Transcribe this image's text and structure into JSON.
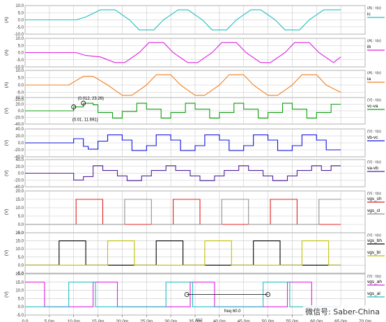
{
  "time_axis": {
    "label": "t(s)",
    "ticks": [
      "0.0",
      "5.0m",
      "10.0m",
      "15.0m",
      "20.0m",
      "25.0m",
      "30.0m",
      "35.0m",
      "40.0m",
      "45.0m",
      "50.0m",
      "55.0m",
      "60.0m",
      "65.0m",
      "70.0m"
    ],
    "xlim": [
      0,
      0.07
    ]
  },
  "watermark": "微信号: Saber-China",
  "chart_data": [
    {
      "type": "line",
      "ylabel": "(A)",
      "unit_label": "(A) : t(s)",
      "ylim": [
        -10,
        10
      ],
      "yticks": [
        "10.0",
        "5.0",
        "0.0",
        "-5.0",
        "-10.0"
      ],
      "series": [
        {
          "name": "ic",
          "color": "#20c0c0",
          "x": [
            0,
            0.0105,
            0.0125,
            0.0155,
            0.0185,
            0.0215,
            0.0235,
            0.0265,
            0.0285,
            0.0315,
            0.0335,
            0.0365,
            0.0385,
            0.0415,
            0.0435,
            0.0465,
            0.0485,
            0.0515,
            0.0535,
            0.0565,
            0.0585,
            0.0615,
            0.0635,
            0.065
          ],
          "y": [
            0,
            0,
            2,
            7,
            7,
            0,
            -7,
            -7,
            0,
            7,
            7,
            0,
            -7,
            -7,
            0,
            7,
            7,
            0,
            -7,
            -7,
            0,
            7,
            7,
            7
          ]
        }
      ]
    },
    {
      "type": "line",
      "ylabel": "(A)",
      "unit_label": "(A) : t(s)",
      "ylim": [
        -10,
        10
      ],
      "yticks": [
        "10.0",
        "5.0",
        "0.0",
        "-5.0",
        "-10.0"
      ],
      "series": [
        {
          "name": "ib",
          "color": "#e020e0",
          "x": [
            0,
            0.0105,
            0.0125,
            0.0155,
            0.0185,
            0.0205,
            0.0235,
            0.0255,
            0.0285,
            0.0305,
            0.0335,
            0.0355,
            0.0385,
            0.0405,
            0.0435,
            0.0455,
            0.0485,
            0.0505,
            0.0535,
            0.0555,
            0.0585,
            0.0605,
            0.0635,
            0.065
          ],
          "y": [
            0,
            0,
            -2,
            -3,
            -7,
            -7,
            0,
            7,
            7,
            0,
            -7,
            -7,
            0,
            7,
            7,
            0,
            -7,
            -7,
            0,
            7,
            7,
            0,
            -7,
            -3
          ]
        }
      ]
    },
    {
      "type": "line",
      "ylabel": "(A)",
      "unit_label": "(A) : t(s)",
      "ylim": [
        -10,
        10
      ],
      "yticks": [
        "10.0",
        "5.0",
        "0.0",
        "-5.0",
        "-10.0"
      ],
      "series": [
        {
          "name": "ia",
          "color": "#f08020",
          "x": [
            0,
            0.009,
            0.012,
            0.014,
            0.017,
            0.02,
            0.022,
            0.025,
            0.027,
            0.03,
            0.032,
            0.035,
            0.037,
            0.04,
            0.042,
            0.045,
            0.047,
            0.05,
            0.052,
            0.055,
            0.057,
            0.06,
            0.062,
            0.065
          ],
          "y": [
            0,
            0,
            6,
            6,
            0,
            -7,
            -7,
            0,
            7,
            7,
            0,
            -7,
            -7,
            0,
            7,
            7,
            0,
            -7,
            -7,
            0,
            7,
            7,
            0,
            -5
          ]
        }
      ]
    },
    {
      "type": "line",
      "ylabel": "(V)",
      "unit_label": "(V) : t(s)",
      "ylim": [
        -40,
        40
      ],
      "yticks": [
        "40.0",
        "20.0",
        "0.0",
        "-20.0",
        "-40.0"
      ],
      "series": [
        {
          "name": "vc-va",
          "color": "#10a010",
          "x": [
            0,
            0.01,
            0.01,
            0.012,
            0.012,
            0.014,
            0.014,
            0.015,
            0.015,
            0.018,
            0.018,
            0.02,
            0.02,
            0.023,
            0.023,
            0.025,
            0.025,
            0.028,
            0.028,
            0.03,
            0.03,
            0.033,
            0.033,
            0.035,
            0.035,
            0.038,
            0.038,
            0.04,
            0.04,
            0.043,
            0.043,
            0.045,
            0.045,
            0.048,
            0.048,
            0.05,
            0.05,
            0.053,
            0.053,
            0.055,
            0.055,
            0.058,
            0.058,
            0.06,
            0.06,
            0.063,
            0.063,
            0.065
          ],
          "y": [
            0,
            0,
            12,
            12,
            23,
            23,
            18,
            18,
            -5,
            -5,
            -22,
            -22,
            -2,
            -2,
            23,
            23,
            5,
            5,
            -22,
            -22,
            -5,
            -5,
            23,
            23,
            5,
            5,
            -22,
            -22,
            -5,
            -5,
            23,
            23,
            5,
            5,
            -22,
            -22,
            -5,
            -5,
            23,
            23,
            5,
            5,
            -22,
            -22,
            -5,
            -5,
            20,
            20
          ]
        }
      ],
      "annotations": [
        {
          "text": "(0.012, 23.26)",
          "x": 0.012,
          "y": 23.26
        },
        {
          "text": "(0.01, 11.691)",
          "x": 0.01,
          "y": 11.691
        }
      ]
    },
    {
      "type": "line",
      "ylabel": "(V)",
      "unit_label": "(V) : t(s)",
      "ylim": [
        -40,
        40
      ],
      "yticks": [
        "40.0",
        "20.0",
        "0.0",
        "-20.0",
        "-40.0"
      ],
      "series": [
        {
          "name": "vb-vc",
          "color": "#1010e0",
          "x": [
            0,
            0.01,
            0.01,
            0.012,
            0.012,
            0.013,
            0.013,
            0.015,
            0.015,
            0.017,
            0.017,
            0.02,
            0.02,
            0.022,
            0.022,
            0.025,
            0.025,
            0.027,
            0.027,
            0.03,
            0.03,
            0.032,
            0.032,
            0.035,
            0.035,
            0.037,
            0.037,
            0.04,
            0.04,
            0.042,
            0.042,
            0.045,
            0.045,
            0.047,
            0.047,
            0.05,
            0.05,
            0.052,
            0.052,
            0.055,
            0.055,
            0.057,
            0.057,
            0.06,
            0.06,
            0.062,
            0.062,
            0.065
          ],
          "y": [
            0,
            0,
            12,
            12,
            -10,
            -10,
            -18,
            -18,
            5,
            5,
            23,
            23,
            8,
            8,
            -22,
            -22,
            -8,
            -8,
            23,
            23,
            8,
            8,
            -22,
            -22,
            -8,
            -8,
            23,
            23,
            8,
            8,
            -22,
            -22,
            -8,
            -8,
            23,
            23,
            8,
            8,
            -22,
            -22,
            -8,
            -8,
            23,
            23,
            8,
            8,
            -20,
            -20
          ]
        }
      ]
    },
    {
      "type": "line",
      "ylabel": "(V)",
      "unit_label": "(V) : t(s)",
      "ylim": [
        -40,
        40
      ],
      "yticks": [
        "40.0",
        "20.0",
        "0.0",
        "-20.0",
        "-40.0"
      ],
      "series": [
        {
          "name": "va-vb",
          "color": "#5020a0",
          "x": [
            0,
            0.01,
            0.01,
            0.012,
            0.012,
            0.014,
            0.014,
            0.016,
            0.016,
            0.019,
            0.019,
            0.021,
            0.021,
            0.024,
            0.024,
            0.026,
            0.026,
            0.029,
            0.029,
            0.031,
            0.031,
            0.034,
            0.034,
            0.036,
            0.036,
            0.039,
            0.039,
            0.041,
            0.041,
            0.044,
            0.044,
            0.046,
            0.046,
            0.049,
            0.049,
            0.051,
            0.051,
            0.054,
            0.054,
            0.056,
            0.056,
            0.059,
            0.059,
            0.061,
            0.061,
            0.063,
            0.063,
            0.065
          ],
          "y": [
            0,
            0,
            -20,
            -20,
            -10,
            -10,
            22,
            22,
            8,
            8,
            -8,
            -8,
            -22,
            -22,
            -8,
            -8,
            8,
            8,
            22,
            22,
            8,
            8,
            -8,
            -8,
            -22,
            -22,
            -8,
            -8,
            8,
            8,
            22,
            22,
            8,
            8,
            -8,
            -8,
            -22,
            -22,
            -8,
            -8,
            8,
            8,
            22,
            22,
            8,
            8,
            22,
            22
          ]
        }
      ]
    },
    {
      "type": "line",
      "ylabel": "(V)",
      "unit_label": "(V) : t(s)",
      "ylim": [
        -5,
        20
      ],
      "yticks": [
        "20.0",
        "15.0",
        "10.0",
        "5.0",
        "0.0",
        "-5.0"
      ],
      "series": [
        {
          "name": "vgs_ch",
          "color": "#e02020",
          "x": [
            0,
            0.0105,
            0.0105,
            0.016,
            0.016,
            0.0305,
            0.0305,
            0.036,
            0.036,
            0.0505,
            0.0505,
            0.056,
            0.056,
            0.065
          ],
          "y": [
            0,
            0,
            15,
            15,
            0,
            0,
            15,
            15,
            0,
            0,
            15,
            15,
            0,
            0
          ]
        },
        {
          "name": "vgs_cl",
          "color": "#909090",
          "x": [
            0,
            0.0205,
            0.0205,
            0.026,
            0.026,
            0.0405,
            0.0405,
            0.046,
            0.046,
            0.0605,
            0.0605,
            0.065
          ],
          "y": [
            0,
            0,
            15,
            15,
            0,
            0,
            15,
            15,
            0,
            0,
            15,
            15
          ]
        }
      ]
    },
    {
      "type": "line",
      "ylabel": "(V)",
      "unit_label": "(V) : t(s)",
      "ylim": [
        -5,
        20
      ],
      "yticks": [
        "20.0",
        "15.0",
        "10.0",
        "5.0",
        "0.0",
        "-5.0"
      ],
      "series": [
        {
          "name": "vgs_bh",
          "color": "#000000",
          "x": [
            0,
            0.007,
            0.007,
            0.0125,
            0.0125,
            0.027,
            0.027,
            0.0325,
            0.0325,
            0.047,
            0.047,
            0.0525,
            0.0525,
            0.065
          ],
          "y": [
            0,
            0,
            15,
            15,
            0,
            0,
            15,
            15,
            0,
            0,
            15,
            15,
            0,
            0
          ]
        },
        {
          "name": "vgs_bl",
          "color": "#c0c000",
          "x": [
            0,
            0.017,
            0.017,
            0.0225,
            0.0225,
            0.037,
            0.037,
            0.0425,
            0.0425,
            0.057,
            0.057,
            0.0625,
            0.0625,
            0.065
          ],
          "y": [
            0,
            0,
            15,
            15,
            0,
            0,
            15,
            15,
            0,
            0,
            15,
            15,
            0,
            0
          ]
        }
      ]
    },
    {
      "type": "line",
      "ylabel": "(V)",
      "unit_label": "(V) : t(s)",
      "ylim": [
        -5,
        20
      ],
      "yticks": [
        "20.0",
        "15.0",
        "10.0",
        "5.0",
        "0.0",
        "-5.0"
      ],
      "series": [
        {
          "name": "vgs_ah",
          "color": "#e020e0",
          "x": [
            0,
            0.004,
            0.004,
            0.014,
            0.014,
            0.019,
            0.019,
            0.034,
            0.034,
            0.039,
            0.039,
            0.054,
            0.054,
            0.059,
            0.059,
            0.065
          ],
          "y": [
            15,
            15,
            0,
            0,
            15,
            15,
            0,
            0,
            15,
            15,
            0,
            0,
            15,
            15,
            0,
            0
          ]
        },
        {
          "name": "vgs_al",
          "color": "#20c0c0",
          "x": [
            0,
            0.009,
            0.009,
            0.0145,
            0.0145,
            0.029,
            0.029,
            0.0345,
            0.0345,
            0.049,
            0.049,
            0.0545,
            0.0545,
            0.065
          ],
          "y": [
            0,
            0,
            15,
            15,
            0,
            0,
            15,
            15,
            0,
            0,
            15,
            15,
            0,
            0
          ]
        }
      ],
      "annotations": [
        {
          "text": "freq  60.0",
          "x": 0.041,
          "y": 0
        }
      ],
      "freq_markers": [
        0.0333,
        0.05
      ]
    }
  ]
}
